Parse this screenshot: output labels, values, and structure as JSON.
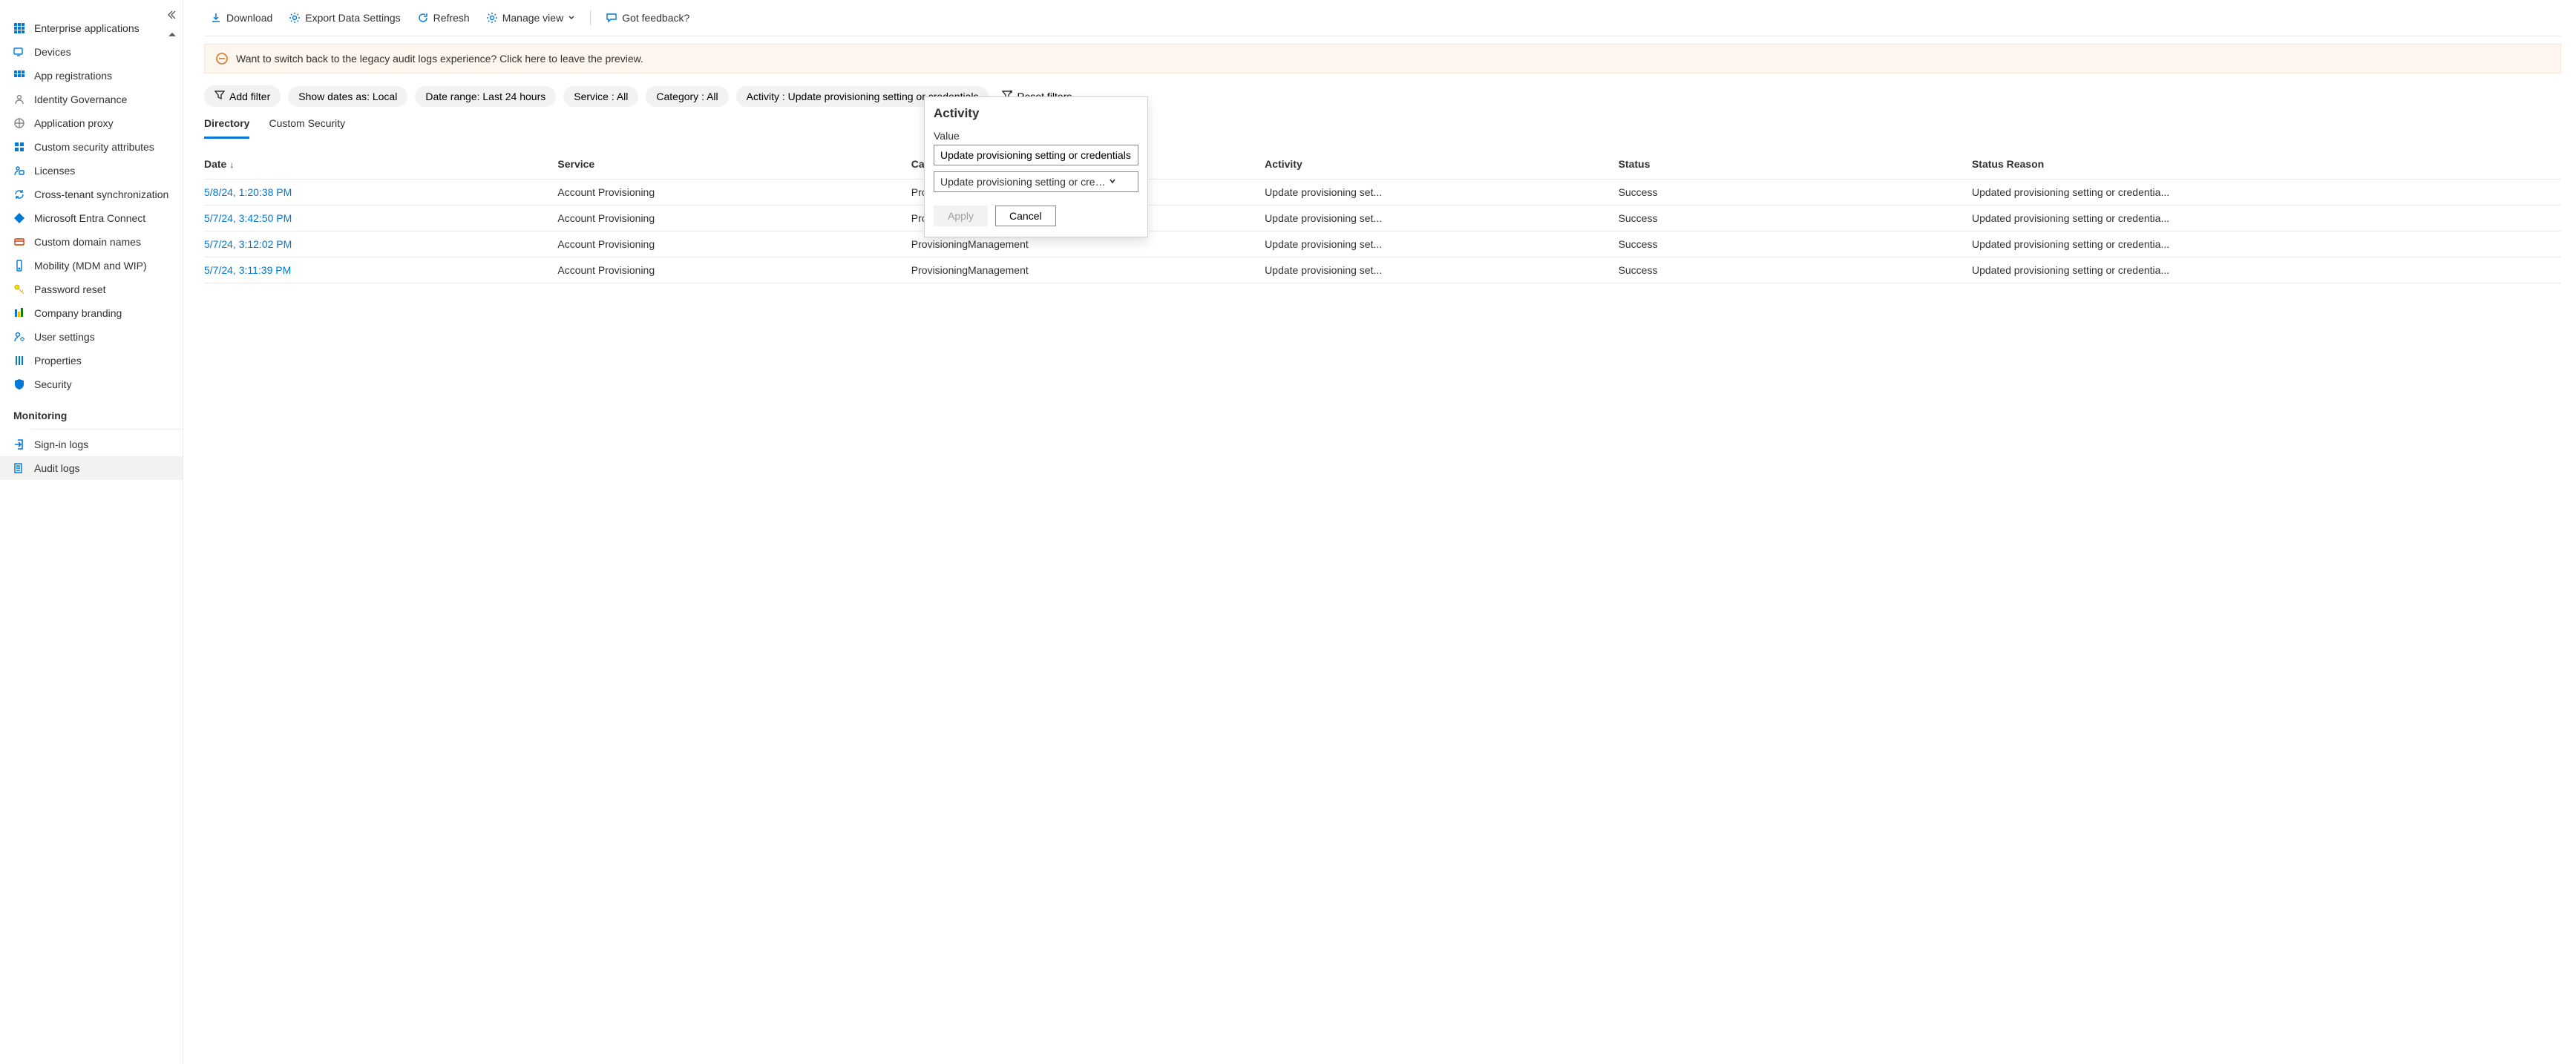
{
  "sidebar": {
    "items": [
      {
        "label": "Enterprise applications",
        "icon_color": "#0078d4"
      },
      {
        "label": "Devices",
        "icon_color": "#0078d4"
      },
      {
        "label": "App registrations",
        "icon_color": "#0078d4"
      },
      {
        "label": "Identity Governance",
        "icon_color": "#8a8886"
      },
      {
        "label": "Application proxy",
        "icon_color": "#8a8886"
      },
      {
        "label": "Custom security attributes",
        "icon_color": "#0078d4"
      },
      {
        "label": "Licenses",
        "icon_color": "#0078d4"
      },
      {
        "label": "Cross-tenant synchronization",
        "icon_color": "#0078d4"
      },
      {
        "label": "Microsoft Entra Connect",
        "icon_color": "#0078d4"
      },
      {
        "label": "Custom domain names",
        "icon_color": "#d83b01"
      },
      {
        "label": "Mobility (MDM and WIP)",
        "icon_color": "#0078d4"
      },
      {
        "label": "Password reset",
        "icon_color": "#fce100"
      },
      {
        "label": "Company branding",
        "icon_color": "#8a8886"
      },
      {
        "label": "User settings",
        "icon_color": "#0078d4"
      },
      {
        "label": "Properties",
        "icon_color": "#0078d4"
      },
      {
        "label": "Security",
        "icon_color": "#0078d4"
      }
    ],
    "monitoring_heading": "Monitoring",
    "monitoring_items": [
      {
        "label": "Sign-in logs"
      },
      {
        "label": "Audit logs"
      }
    ]
  },
  "toolbar": {
    "download": "Download",
    "export": "Export Data Settings",
    "refresh": "Refresh",
    "manage_view": "Manage view",
    "feedback": "Got feedback?"
  },
  "info_bar": {
    "text": "Want to switch back to the legacy audit logs experience? Click here to leave the preview."
  },
  "filters": {
    "add_filter": "Add filter",
    "show_dates": "Show dates as: Local",
    "date_range": "Date range: Last 24 hours",
    "service": "Service : All",
    "category": "Category : All",
    "activity": "Activity : Update provisioning setting or credentials",
    "reset": "Reset filters"
  },
  "tabs": {
    "directory": "Directory",
    "custom_security": "Custom Security"
  },
  "table": {
    "headers": {
      "date": "Date",
      "service": "Service",
      "category": "Category",
      "activity": "Activity",
      "status": "Status",
      "status_reason": "Status Reason"
    },
    "rows": [
      {
        "date": "5/8/24, 1:20:38 PM",
        "service": "Account Provisioning",
        "category": "ProvisioningManagement",
        "activity": "Update provisioning set...",
        "status": "Success",
        "status_reason": "Updated provisioning setting or credentia..."
      },
      {
        "date": "5/7/24, 3:42:50 PM",
        "service": "Account Provisioning",
        "category": "ProvisioningManagement",
        "activity": "Update provisioning set...",
        "status": "Success",
        "status_reason": "Updated provisioning setting or credentia..."
      },
      {
        "date": "5/7/24, 3:12:02 PM",
        "service": "Account Provisioning",
        "category": "ProvisioningManagement",
        "activity": "Update provisioning set...",
        "status": "Success",
        "status_reason": "Updated provisioning setting or credentia..."
      },
      {
        "date": "5/7/24, 3:11:39 PM",
        "service": "Account Provisioning",
        "category": "ProvisioningManagement",
        "activity": "Update provisioning set...",
        "status": "Success",
        "status_reason": "Updated provisioning setting or credentia..."
      }
    ]
  },
  "popover": {
    "title": "Activity",
    "value_label": "Value",
    "value": "Update provisioning setting or credentials",
    "select_value": "Update provisioning setting or credentials",
    "apply": "Apply",
    "cancel": "Cancel"
  }
}
